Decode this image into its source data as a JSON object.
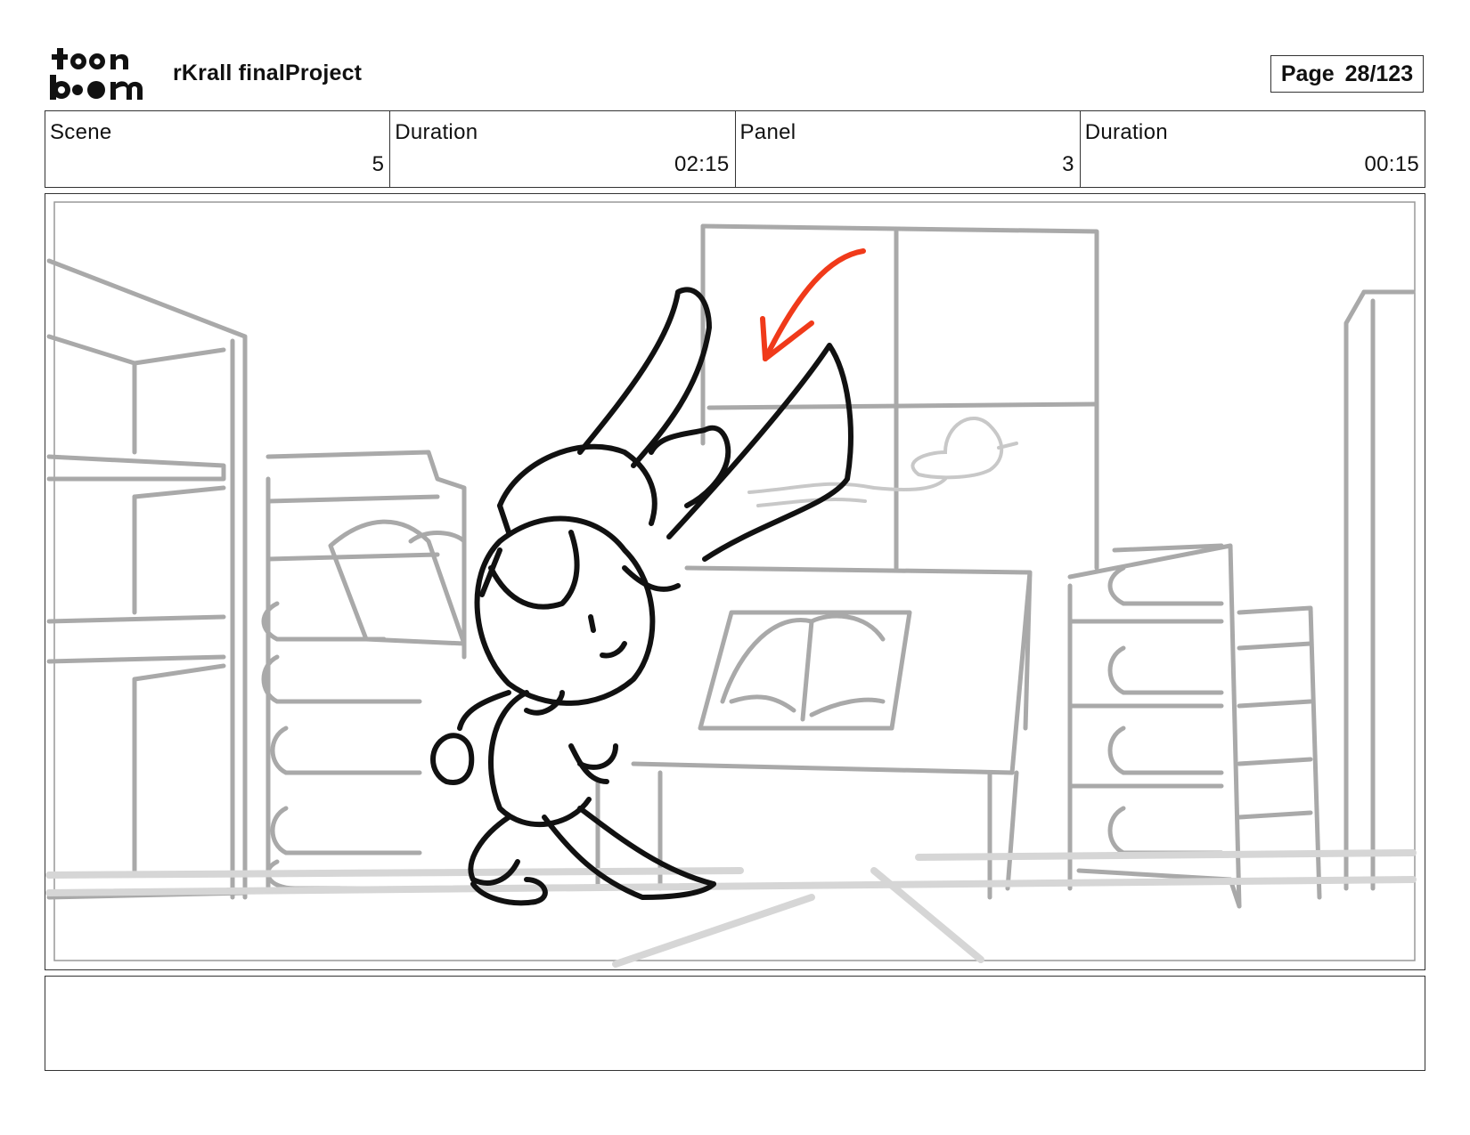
{
  "header": {
    "logo_text": "toon boom",
    "project_title": "rKrall finalProject",
    "page_label": "Page",
    "page_number": "28/123"
  },
  "info": {
    "scene_label": "Scene",
    "scene_value": "5",
    "scene_duration_label": "Duration",
    "scene_duration_value": "02:15",
    "panel_label": "Panel",
    "panel_value": "3",
    "panel_duration_label": "Duration",
    "panel_duration_value": "00:15"
  },
  "panel": {
    "drawing": "storyboard-sketch",
    "arrow_color": "#f03a1a",
    "line_color": "#111111",
    "background_line_color": "#a8a8a8"
  },
  "notes": {
    "text": ""
  }
}
